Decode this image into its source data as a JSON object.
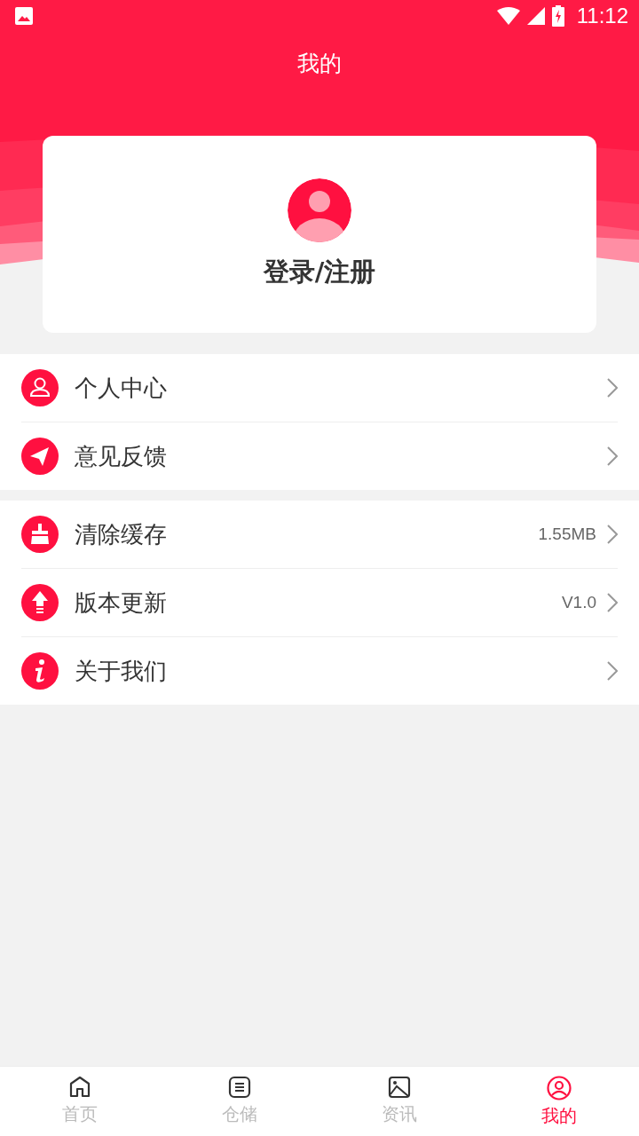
{
  "status_bar": {
    "time": "11:12"
  },
  "title": "我的",
  "profile": {
    "login_label": "登录/注册"
  },
  "menu_groups": [
    [
      {
        "label": "个人中心"
      },
      {
        "label": "意见反馈"
      }
    ],
    [
      {
        "label": "清除缓存",
        "value": "1.55MB"
      },
      {
        "label": "版本更新",
        "value": "V1.0"
      },
      {
        "label": "关于我们"
      }
    ]
  ],
  "tabs": [
    {
      "label": "首页",
      "selected": false
    },
    {
      "label": "仓储",
      "selected": false
    },
    {
      "label": "资讯",
      "selected": false
    },
    {
      "label": "我的",
      "selected": true
    }
  ]
}
